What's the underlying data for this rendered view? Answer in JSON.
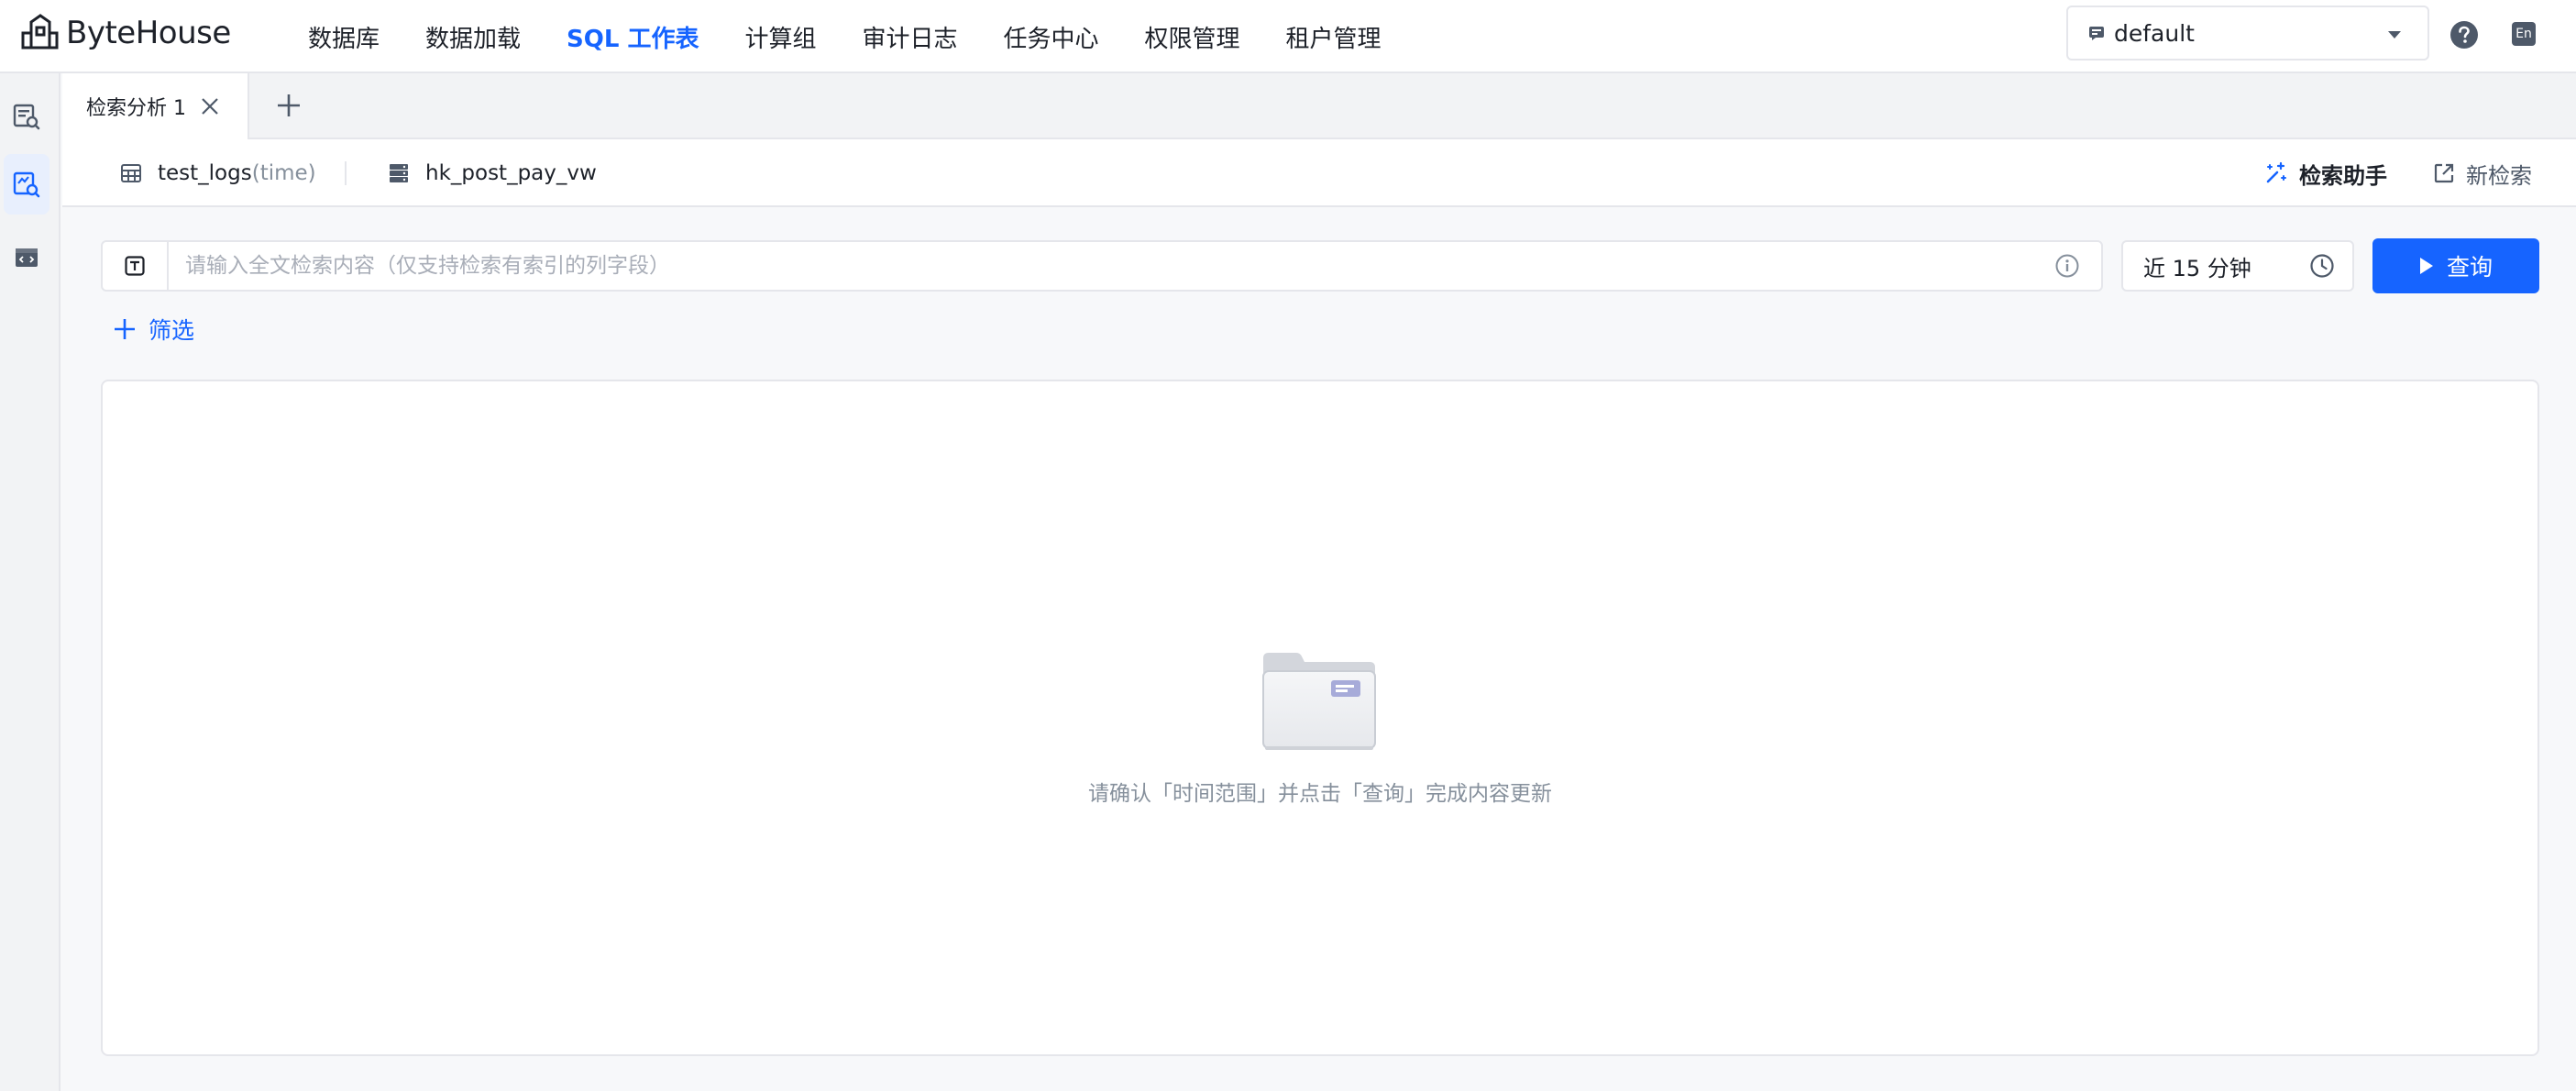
{
  "app": {
    "name": "ByteHouse"
  },
  "nav": {
    "items": [
      {
        "label": "数据库",
        "active": false
      },
      {
        "label": "数据加载",
        "active": false
      },
      {
        "label": "SQL 工作表",
        "active": true
      },
      {
        "label": "计算组",
        "active": false
      },
      {
        "label": "审计日志",
        "active": false
      },
      {
        "label": "任务中心",
        "active": false
      },
      {
        "label": "权限管理",
        "active": false
      },
      {
        "label": "租户管理",
        "active": false
      }
    ],
    "database_select": "default",
    "help_icon": "question-circle-icon",
    "language_toggle": "En"
  },
  "rail": {
    "items": [
      {
        "icon": "sql-query-icon",
        "active": false
      },
      {
        "icon": "search-analysis-icon",
        "active": true
      },
      {
        "icon": "code-panel-icon",
        "active": false
      }
    ]
  },
  "tabs": {
    "items": [
      {
        "label": "检索分析 1",
        "active": true
      }
    ],
    "add_icon": "plus-icon"
  },
  "sources": {
    "table_name": "test_logs",
    "table_time": "(time)",
    "view_name": "hk_post_pay_vw",
    "assistant_label": "检索助手",
    "new_search_label": "新检索"
  },
  "query": {
    "placeholder": "请输入全文检索内容（仅支持检索有索引的列字段）",
    "value": "",
    "time_range": "近 15 分钟",
    "submit_label": "查询",
    "filter_label": "筛选"
  },
  "result": {
    "empty_message": "请确认「时间范围」并点击「查询」完成内容更新"
  },
  "colors": {
    "accent": "#1664ff",
    "text_primary": "#1d2129",
    "text_secondary": "#86909c",
    "border": "#e5e6eb",
    "background": "#f7f8fa"
  }
}
